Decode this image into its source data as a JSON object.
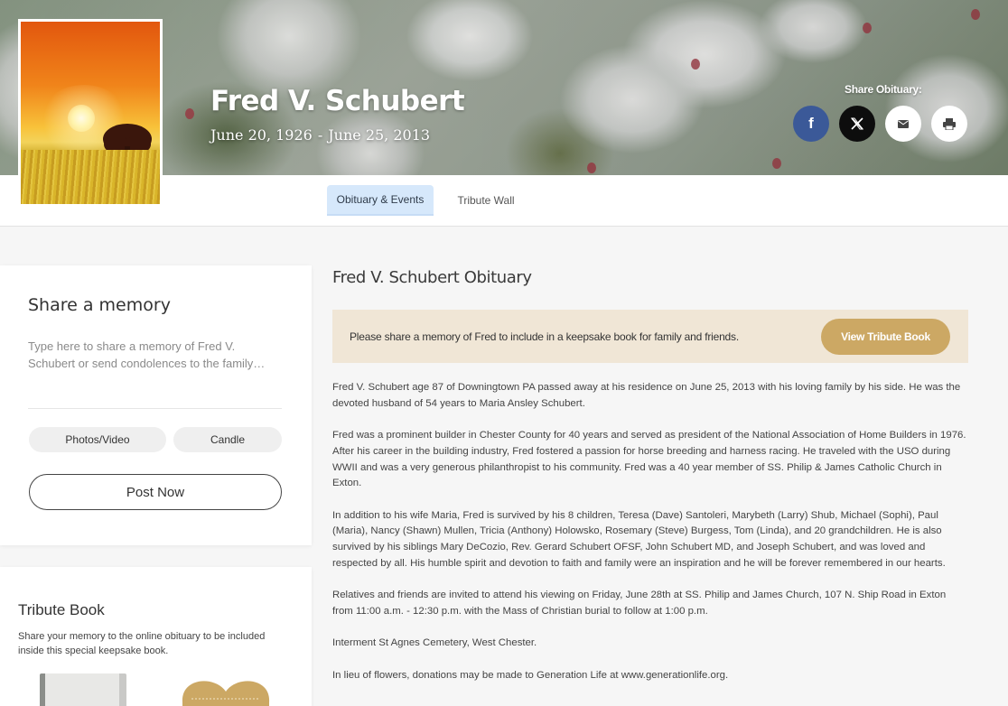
{
  "hero": {
    "name": "Fred V. Schubert",
    "birth_date": "June 20, 1926",
    "date_separator": "-",
    "death_date": "June 25, 2013",
    "share_label": "Share Obituary:",
    "share_buttons": [
      {
        "name": "facebook",
        "glyph": "f"
      },
      {
        "name": "x",
        "glyph": "𝕏"
      },
      {
        "name": "email",
        "glyph": "✉"
      },
      {
        "name": "print",
        "glyph": "print"
      }
    ]
  },
  "tabs": [
    {
      "label": "Obituary & Events",
      "active": true
    },
    {
      "label": "Tribute Wall",
      "active": false
    }
  ],
  "memory": {
    "title": "Share a memory",
    "placeholder": "Type here to share a memory of Fred V. Schubert or send condolences to the family…",
    "photos_label": "Photos/Video",
    "candle_label": "Candle",
    "post_label": "Post Now"
  },
  "tribute_book": {
    "title": "Tribute Book",
    "description": "Share your memory to the online obituary to be included inside this special keepsake book."
  },
  "obituary": {
    "title": "Fred V. Schubert Obituary",
    "banner_text": "Please share a memory of Fred to include in a keepsake book for family and friends.",
    "banner_button": "View Tribute Book",
    "paragraphs": [
      "Fred V. Schubert age 87 of Downingtown PA passed away at his residence on June 25, 2013 with his loving family by his side. He was the devoted husband of 54 years to Maria Ansley Schubert.",
      "Fred was a prominent builder in Chester County for 40 years and served as president of the National Association of Home Builders in 1976. After his career in the building industry, Fred fostered a passion for horse breeding and harness racing. He traveled with the USO during WWII and was a very generous philanthropist to his community. Fred was a 40 year member of SS. Philip & James Catholic Church in Exton.",
      "In addition to his wife Maria, Fred is survived by his 8 children, Teresa (Dave) Santoleri, Marybeth (Larry) Shub, Michael (Sophi), Paul (Maria), Nancy (Shawn) Mullen, Tricia (Anthony) Holowsko, Rosemary (Steve) Burgess, Tom (Linda), and 20 grandchildren. He is also survived by his siblings Mary DeCozio, Rev. Gerard Schubert OFSF, John Schubert MD, and Joseph Schubert, and was loved and respected by all. His humble spirit and devotion to faith and family were an inspiration and he will be forever remembered in our hearts.",
      "Relatives and friends are invited to attend his viewing on Friday, June 28th at SS. Philip and James Church, 107 N. Ship Road in Exton from 11:00 a.m. - 12:30 p.m. with the Mass of Christian burial to follow at 1:00 p.m.",
      "Interment St Agnes Cemetery, West Chester.",
      "In lieu of flowers, donations may be made to Generation Life at www.generationlife.org."
    ]
  },
  "colors": {
    "facebook": "#3b5998",
    "active_tab": "#d6e8fb",
    "banner_bg": "#f0e6d6",
    "banner_button": "#cca864"
  }
}
